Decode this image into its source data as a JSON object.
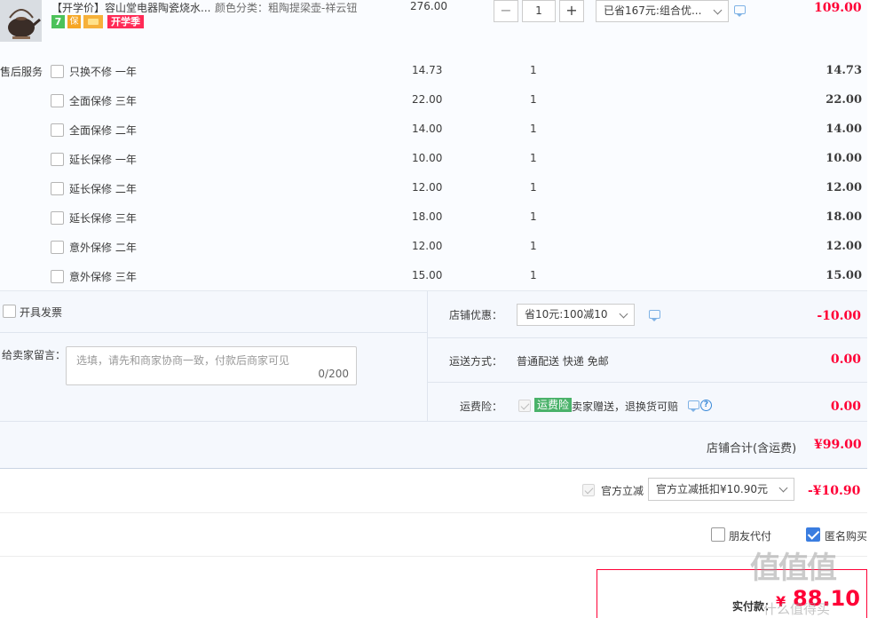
{
  "product": {
    "title": "【开学价】容山堂电器陶瓷烧水...",
    "sku": "颜色分类：粗陶提梁壶-祥云钮",
    "badges": {
      "seven": "7",
      "bao": "保",
      "school": "开学季"
    },
    "price": "276.00",
    "quantity": "1",
    "qty_minus": "−",
    "qty_plus": "+",
    "promo": "已省167元:组合优...",
    "subtotal": "109.00"
  },
  "services": {
    "label": "售后服务",
    "items": [
      {
        "name": "只换不修 一年",
        "price": "14.73",
        "qty": "1",
        "subtotal": "14.73"
      },
      {
        "name": "全面保修 三年",
        "price": "22.00",
        "qty": "1",
        "subtotal": "22.00"
      },
      {
        "name": "全面保修 二年",
        "price": "14.00",
        "qty": "1",
        "subtotal": "14.00"
      },
      {
        "name": "延长保修 一年",
        "price": "10.00",
        "qty": "1",
        "subtotal": "10.00"
      },
      {
        "name": "延长保修 二年",
        "price": "12.00",
        "qty": "1",
        "subtotal": "12.00"
      },
      {
        "name": "延长保修 三年",
        "price": "18.00",
        "qty": "1",
        "subtotal": "18.00"
      },
      {
        "name": "意外保修 二年",
        "price": "12.00",
        "qty": "1",
        "subtotal": "12.00"
      },
      {
        "name": "意外保修 三年",
        "price": "15.00",
        "qty": "1",
        "subtotal": "15.00"
      }
    ]
  },
  "invoice": {
    "label": "开具发票"
  },
  "message": {
    "label": "给卖家留言：",
    "placeholder": "选填，请先和商家协商一致，付款后商家可见",
    "count": "0/200"
  },
  "shop_discount": {
    "label": "店铺优惠：",
    "selected": "省10元:100减10",
    "amount": "-10.00"
  },
  "shipping": {
    "label": "运送方式：",
    "value": "普通配送 快递 免邮",
    "amount": "0.00"
  },
  "insurance": {
    "label": "运费险：",
    "tag": "运费险",
    "text": "卖家赠送，退换货可赔",
    "help": "?",
    "amount": "0.00"
  },
  "shop_total": {
    "label": "店铺合计(含运费)",
    "amount": "¥99.00"
  },
  "official_discount": {
    "label": "官方立减",
    "selected": "官方立减抵扣¥10.90元",
    "amount": "-¥10.90"
  },
  "options": {
    "friend_pay": "朋友代付",
    "anonymous": "匿名购买"
  },
  "payment": {
    "label": "实付款：",
    "yen": "¥",
    "amount": "88.10"
  },
  "watermark": {
    "logo": "值值值",
    "url": "什么值得买"
  },
  "colors": {
    "accent": "#ff0036",
    "panel": "#f5f8fd",
    "check": "#3a7de0",
    "tag_green": "#4ab26a"
  }
}
